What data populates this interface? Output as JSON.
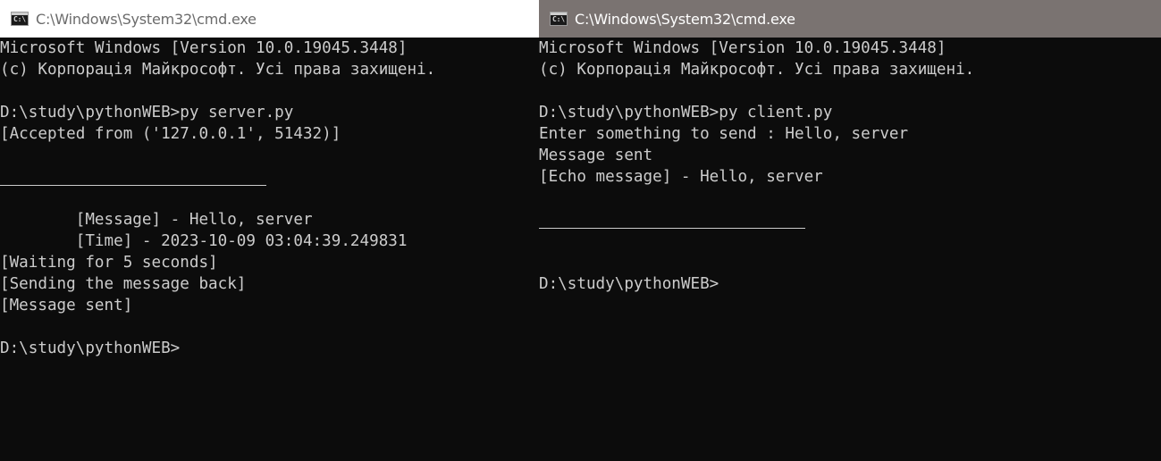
{
  "windows": {
    "left": {
      "title": "C:\\Windows\\System32\\cmd.exe",
      "icon": "cmd-icon",
      "icon_text": "C:\\",
      "lines": [
        "Microsoft Windows [Version 10.0.19045.3448]",
        "(c) Корпорація Майкрософт. Усі права захищені.",
        "",
        "D:\\study\\pythonWEB>py server.py",
        "[Accepted from ('127.0.0.1', 51432)]",
        "",
        "__RULE__",
        "",
        "        [Message] - Hello, server",
        "        [Time] - 2023-10-09 03:04:39.249831",
        "[Waiting for 5 seconds]",
        "[Sending the message back]",
        "[Message sent]",
        "",
        "D:\\study\\pythonWEB>"
      ]
    },
    "right": {
      "title": "C:\\Windows\\System32\\cmd.exe",
      "icon": "cmd-icon",
      "icon_text": "C:\\",
      "lines": [
        "Microsoft Windows [Version 10.0.19045.3448]",
        "(c) Корпорація Майкрософт. Усі права захищені.",
        "",
        "D:\\study\\pythonWEB>py client.py",
        "Enter something to send : Hello, server",
        "Message sent",
        "[Echo message] - Hello, server",
        "",
        "__RULE__",
        "",
        "",
        "D:\\study\\pythonWEB>"
      ]
    }
  },
  "colors": {
    "console_bg": "#0c0c0c",
    "console_fg": "#cccccc",
    "inactive_titlebar_bg": "#ffffff",
    "active_titlebar_bg": "#7a7371"
  }
}
